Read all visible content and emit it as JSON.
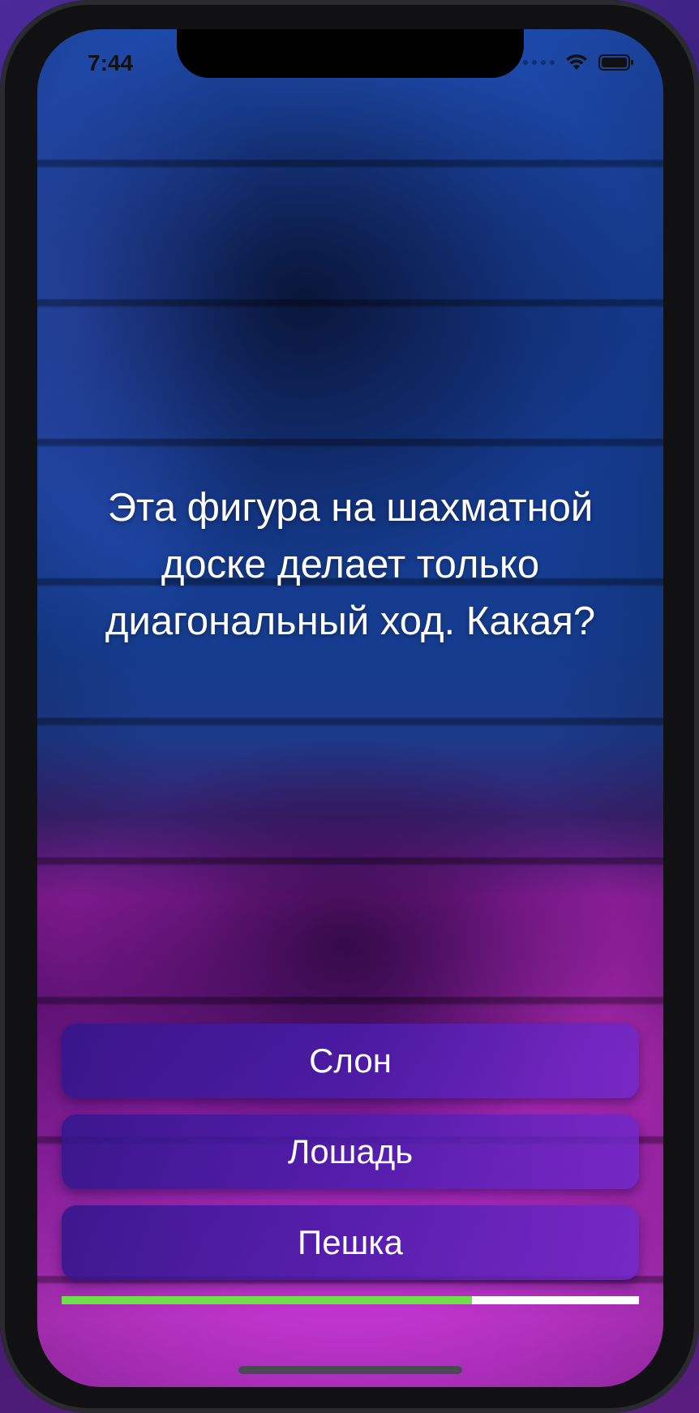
{
  "status_bar": {
    "time": "7:44",
    "icons": [
      "signal-dots-icon",
      "wifi-icon",
      "battery-icon"
    ]
  },
  "quiz": {
    "question": "Эта фигура на шахматной доске делает только диагональный ход. Какая?",
    "answers": [
      {
        "label": "Слон"
      },
      {
        "label": "Лошадь"
      },
      {
        "label": "Пешка"
      }
    ],
    "timer_progress_fraction": 0.71
  },
  "colors": {
    "progress_fill": "#6de04a",
    "progress_track": "#ffffff",
    "answer_button": "#3a1c8c"
  }
}
